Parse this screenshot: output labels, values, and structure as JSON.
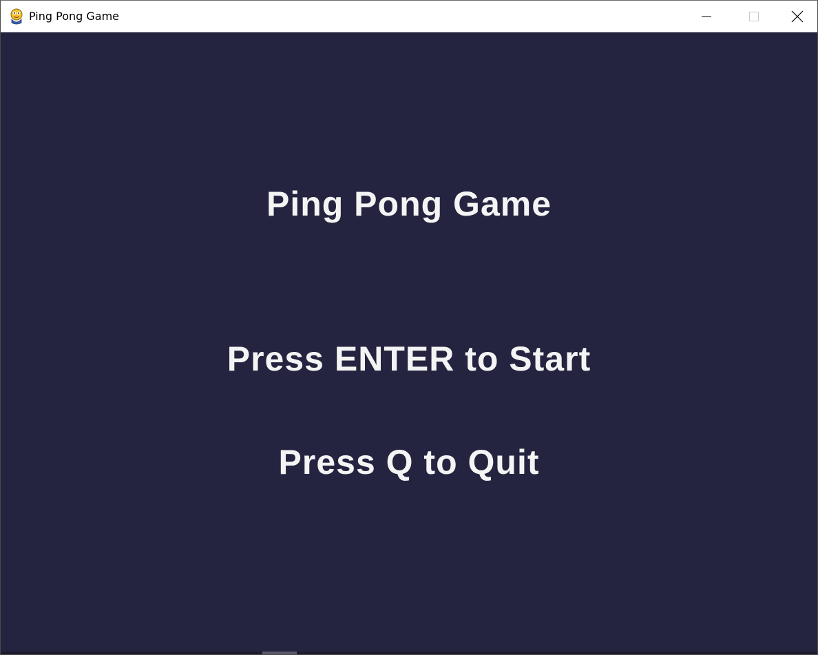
{
  "window": {
    "title": "Ping Pong Game",
    "app_icon": "pygame-snake-icon",
    "controls": {
      "minimize_icon": "minimize-icon",
      "maximize_icon": "maximize-icon",
      "close_icon": "close-icon"
    }
  },
  "menu": {
    "title": "Ping Pong Game",
    "start_prompt": "Press ENTER to Start",
    "quit_prompt": "Press Q to Quit"
  },
  "colors": {
    "background": "#242440",
    "text": "#f4f4f4"
  }
}
